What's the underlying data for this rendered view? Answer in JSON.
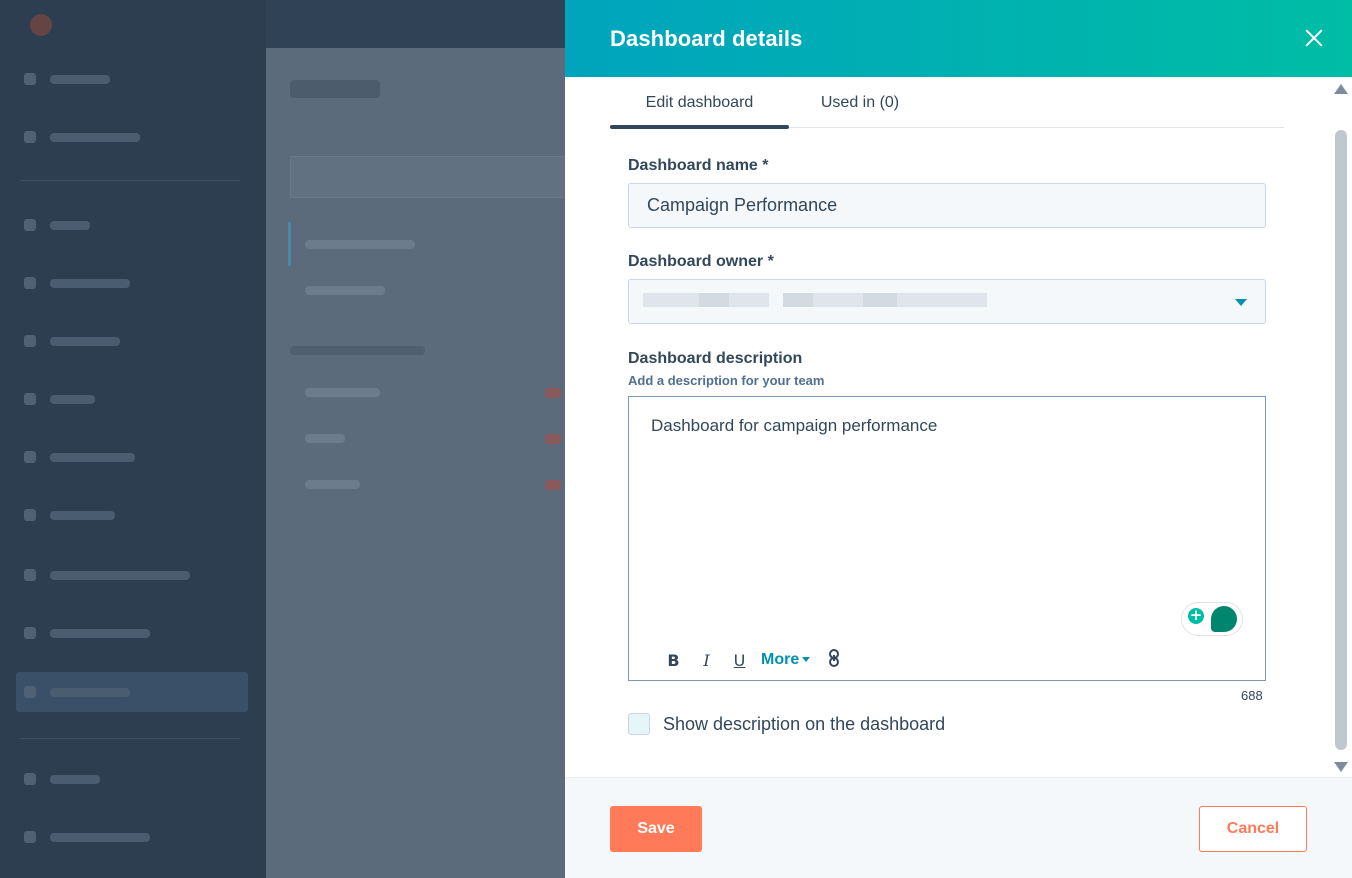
{
  "panel": {
    "title": "Dashboard details",
    "close_icon": "close-icon"
  },
  "tabs": [
    {
      "label": "Edit dashboard",
      "active": true
    },
    {
      "label": "Used in (0)",
      "active": false
    }
  ],
  "form": {
    "name_label": "Dashboard name *",
    "name_value": "Campaign Performance",
    "owner_label": "Dashboard owner *",
    "owner_value_redacted": true,
    "description_label": "Dashboard description",
    "description_hint": "Add a description for your team",
    "description_value": "Dashboard for campaign performance",
    "char_counter": "688",
    "toolbar": {
      "bold": "B",
      "italic": "I",
      "underline": "U",
      "more": "More",
      "link_icon": "link-icon"
    },
    "show_description_label": "Show description on the dashboard",
    "show_description_checked": false
  },
  "footer": {
    "save_label": "Save",
    "cancel_label": "Cancel"
  },
  "colors": {
    "header_gradient_start": "#00a4bd",
    "header_gradient_end": "#00bda5",
    "primary_button": "#ff7a59",
    "link": "#0091ae",
    "text": "#33475b"
  }
}
